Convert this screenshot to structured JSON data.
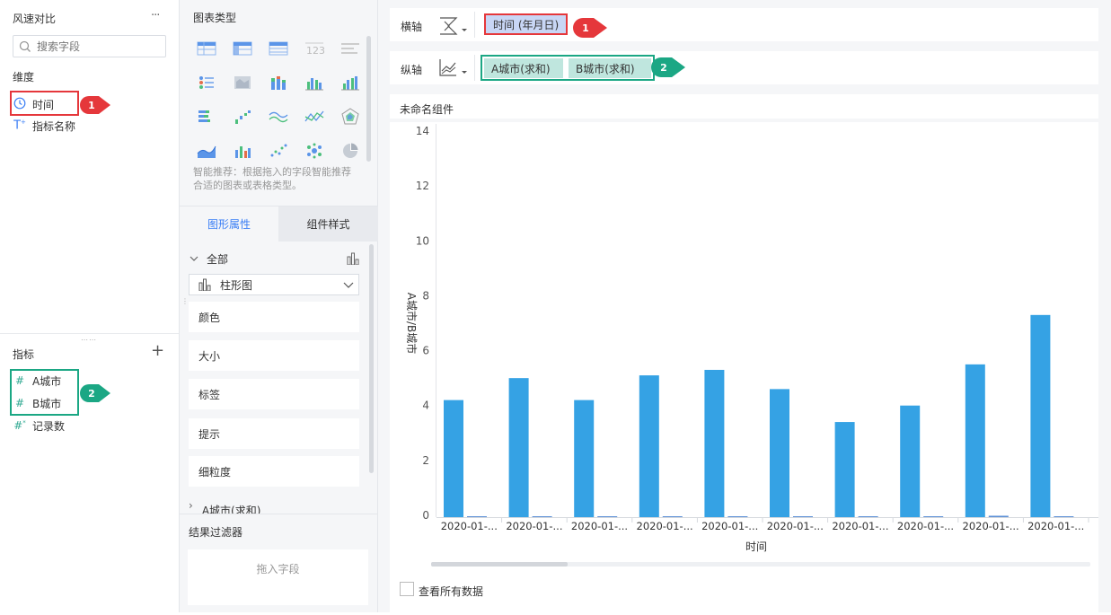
{
  "left": {
    "title": "风速对比",
    "more": "···",
    "search_placeholder": "搜索字段",
    "dimension_title": "维度",
    "dimensions": [
      {
        "label": "时间",
        "icon": "clock-icon"
      },
      {
        "label": "指标名称",
        "icon": "text-type-icon"
      }
    ],
    "measure_title": "指标",
    "add": "+",
    "measures": [
      {
        "label": "A城市",
        "icon": "hash-icon"
      },
      {
        "label": "B城市",
        "icon": "hash-icon"
      },
      {
        "label": "记录数",
        "icon": "hash-star-icon"
      }
    ],
    "badge1": "1",
    "badge2": "2"
  },
  "mid": {
    "chart_type_title": "图表类型",
    "recommend_text": "智能推荐：根据拖入的字段智能推荐合适的图表或表格类型。",
    "tab_graph": "图形属性",
    "tab_style": "组件样式",
    "all_label": "全部",
    "chart_select": "柱形图",
    "props": [
      "颜色",
      "大小",
      "标签",
      "提示",
      "细粒度"
    ],
    "series_label": "A城市(求和)",
    "filter_title": "结果过滤器",
    "filter_drop": "拖入字段"
  },
  "right": {
    "x_axis_label": "横轴",
    "x_field": "时间 (年月日)",
    "y_axis_label": "纵轴",
    "y_field_a": "A城市(求和)",
    "y_field_b": "B城市(求和)",
    "component_title": "未命名组件",
    "view_all": "查看所有数据",
    "badge1": "1",
    "badge2": "2"
  },
  "colors": {
    "accent": "#3b7ff5",
    "bar": "#35a2e4",
    "red": "#e5373b",
    "green": "#1ba784",
    "pill_blue": "#c8d6f5",
    "pill_teal": "#bfe6de"
  },
  "chart_data": {
    "type": "bar",
    "categories": [
      "2020-01-...",
      "2020-01-...",
      "2020-01-...",
      "2020-01-...",
      "2020-01-...",
      "2020-01-...",
      "2020-01-...",
      "2020-01-...",
      "2020-01-...",
      "2020-01-..."
    ],
    "series": [
      {
        "values": [
          4.2,
          5.0,
          4.2,
          5.1,
          5.3,
          4.6,
          3.4,
          4.0,
          5.5,
          7.3
        ]
      },
      {
        "values": [
          0,
          0,
          0,
          0,
          0,
          0,
          0,
          0,
          0.05,
          0
        ]
      }
    ],
    "xlabel": "时间",
    "ylabel": "A城市/B城市",
    "ylim": [
      0,
      14
    ],
    "yticks": [
      0,
      2,
      4,
      6,
      8,
      10,
      12,
      14
    ],
    "grid": false
  }
}
